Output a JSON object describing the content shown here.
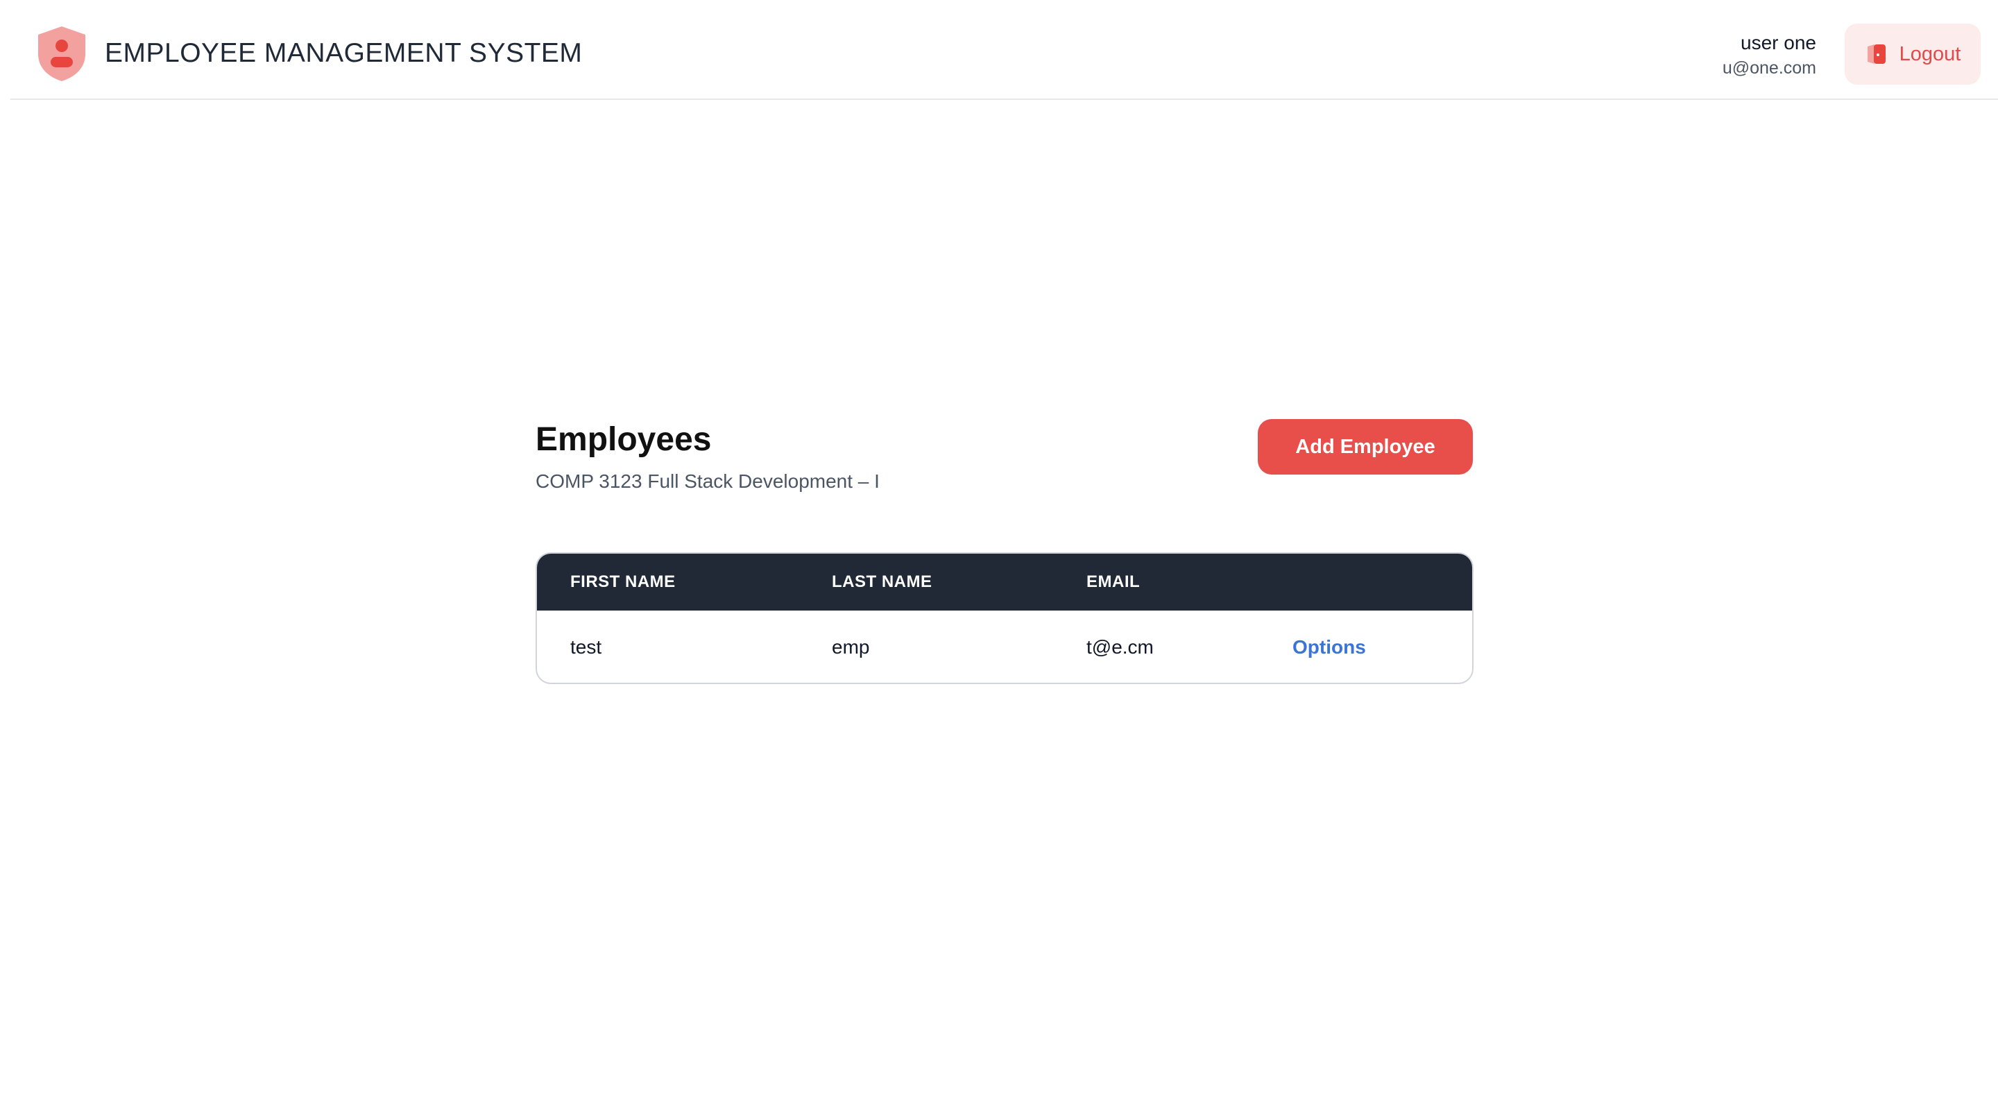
{
  "app": {
    "title": "EMPLOYEE MANAGEMENT SYSTEM",
    "logo_icon": "shield-user-icon"
  },
  "user": {
    "name": "user one",
    "email": "u@one.com"
  },
  "logout": {
    "label": "Logout",
    "icon": "door-exit-icon"
  },
  "page": {
    "title": "Employees",
    "subtitle": "COMP 3123 Full Stack Development – I",
    "add_button_label": "Add Employee"
  },
  "table": {
    "headers": [
      "FIRST NAME",
      "LAST NAME",
      "EMAIL",
      ""
    ],
    "rows": [
      {
        "first_name": "test",
        "last_name": "emp",
        "email": "t@e.cm",
        "action": "Options"
      }
    ]
  },
  "colors": {
    "accent": "#e84f4b",
    "header_dark": "#212836",
    "link": "#3b74d9",
    "logout_bg": "#fcecec"
  }
}
